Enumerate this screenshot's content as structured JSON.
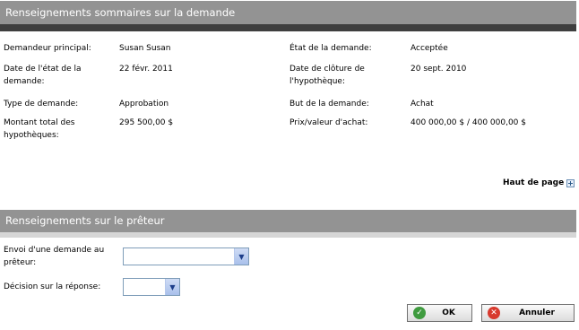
{
  "summary": {
    "title": "Renseignements sommaires sur la demande",
    "rows": [
      {
        "l1": "Demandeur principal:",
        "v1": "Susan Susan",
        "l2": "État de la demande:",
        "v2": "Acceptée"
      },
      {
        "l1": "Date de l'état de la demande:",
        "v1": "22 févr. 2011",
        "l2": "Date de clôture de l'hypothèque:",
        "v2": "20 sept. 2010"
      },
      {
        "l1": "Type de demande:",
        "v1": "Approbation",
        "l2": "But de la demande:",
        "v2": "Achat"
      },
      {
        "l1": "Montant total des hypothèques:",
        "v1": "295 500,00 $",
        "l2": "Prix/valeur d'achat:",
        "v2": "400 000,00 $ / 400 000,00 $"
      }
    ]
  },
  "top_link": "Haut de page",
  "lender": {
    "title": "Renseignements sur le prêteur",
    "send_label": "Envoi d'une demande au prêteur:",
    "send_value": "",
    "decision_label": "Décision sur la réponse:",
    "decision_value": ""
  },
  "buttons": {
    "ok": "OK",
    "cancel": "Annuler"
  }
}
